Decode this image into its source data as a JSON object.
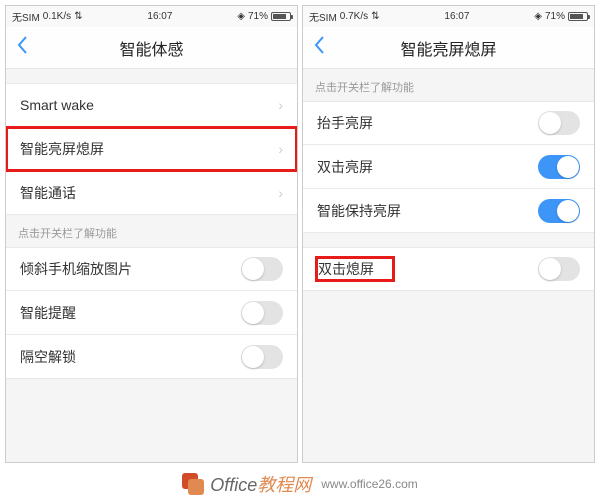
{
  "left": {
    "status": {
      "sim": "无SIM",
      "speed": "0.1K/s",
      "time": "16:07",
      "battery": "71%"
    },
    "nav_title": "智能体感",
    "rows_group1": [
      {
        "label": "Smart wake",
        "type": "chevron"
      },
      {
        "label": "智能亮屏熄屏",
        "type": "chevron",
        "highlight": true
      },
      {
        "label": "智能通话",
        "type": "chevron"
      }
    ],
    "section2_header": "点击开关栏了解功能",
    "rows_group2": [
      {
        "label": "倾斜手机缩放图片",
        "type": "toggle",
        "on": false
      },
      {
        "label": "智能提醒",
        "type": "toggle",
        "on": false
      },
      {
        "label": "隔空解锁",
        "type": "toggle",
        "on": false
      }
    ]
  },
  "right": {
    "status": {
      "sim": "无SIM",
      "speed": "0.7K/s",
      "time": "16:07",
      "battery": "71%"
    },
    "nav_title": "智能亮屏熄屏",
    "section1_header": "点击开关栏了解功能",
    "rows_group1": [
      {
        "label": "抬手亮屏",
        "type": "toggle",
        "on": false
      },
      {
        "label": "双击亮屏",
        "type": "toggle",
        "on": true
      },
      {
        "label": "智能保持亮屏",
        "type": "toggle",
        "on": true
      }
    ],
    "rows_group2": [
      {
        "label": "双击熄屏",
        "type": "toggle",
        "on": false,
        "highlight_label": true
      }
    ]
  },
  "watermark": {
    "brand1": "Office",
    "brand2": "教程网",
    "url": "www.office26.com"
  }
}
